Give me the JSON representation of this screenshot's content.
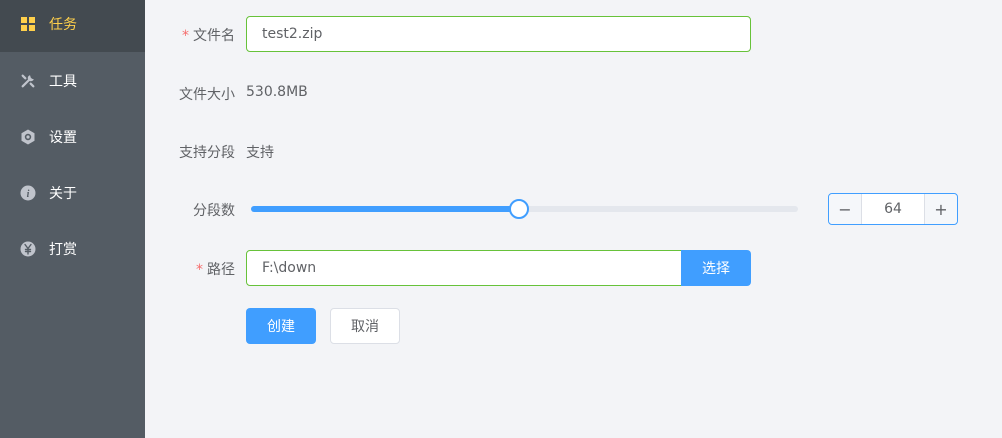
{
  "sidebar": {
    "items": [
      {
        "label": "任务",
        "icon": "grid-icon",
        "active": true
      },
      {
        "label": "工具",
        "icon": "tools-icon",
        "active": false
      },
      {
        "label": "设置",
        "icon": "gear-icon",
        "active": false
      },
      {
        "label": "关于",
        "icon": "info-icon",
        "active": false
      },
      {
        "label": "打赏",
        "icon": "yuan-icon",
        "active": false
      }
    ],
    "colors": {
      "background": "#545c64",
      "active_background": "#434a50",
      "active_text": "#ffd04b",
      "text": "#ffffff"
    }
  },
  "form": {
    "filename": {
      "required_mark": "*",
      "label": "文件名",
      "value": "test2.zip"
    },
    "filesize": {
      "label": "文件大小",
      "value": "530.8MB"
    },
    "segment_support": {
      "label": "支持分段",
      "value": "支持"
    },
    "segments": {
      "label": "分段数",
      "slider_fraction": 0.49,
      "stepper_value": "64",
      "minus_symbol": "−",
      "plus_symbol": "+"
    },
    "path": {
      "required_mark": "*",
      "label": "路径",
      "value": "F:\\down",
      "choose_label": "选择"
    },
    "actions": {
      "create_label": "创建",
      "cancel_label": "取消"
    }
  },
  "colors": {
    "accent": "#409eff",
    "success_border": "#67c23a",
    "required": "#f56c6c"
  }
}
